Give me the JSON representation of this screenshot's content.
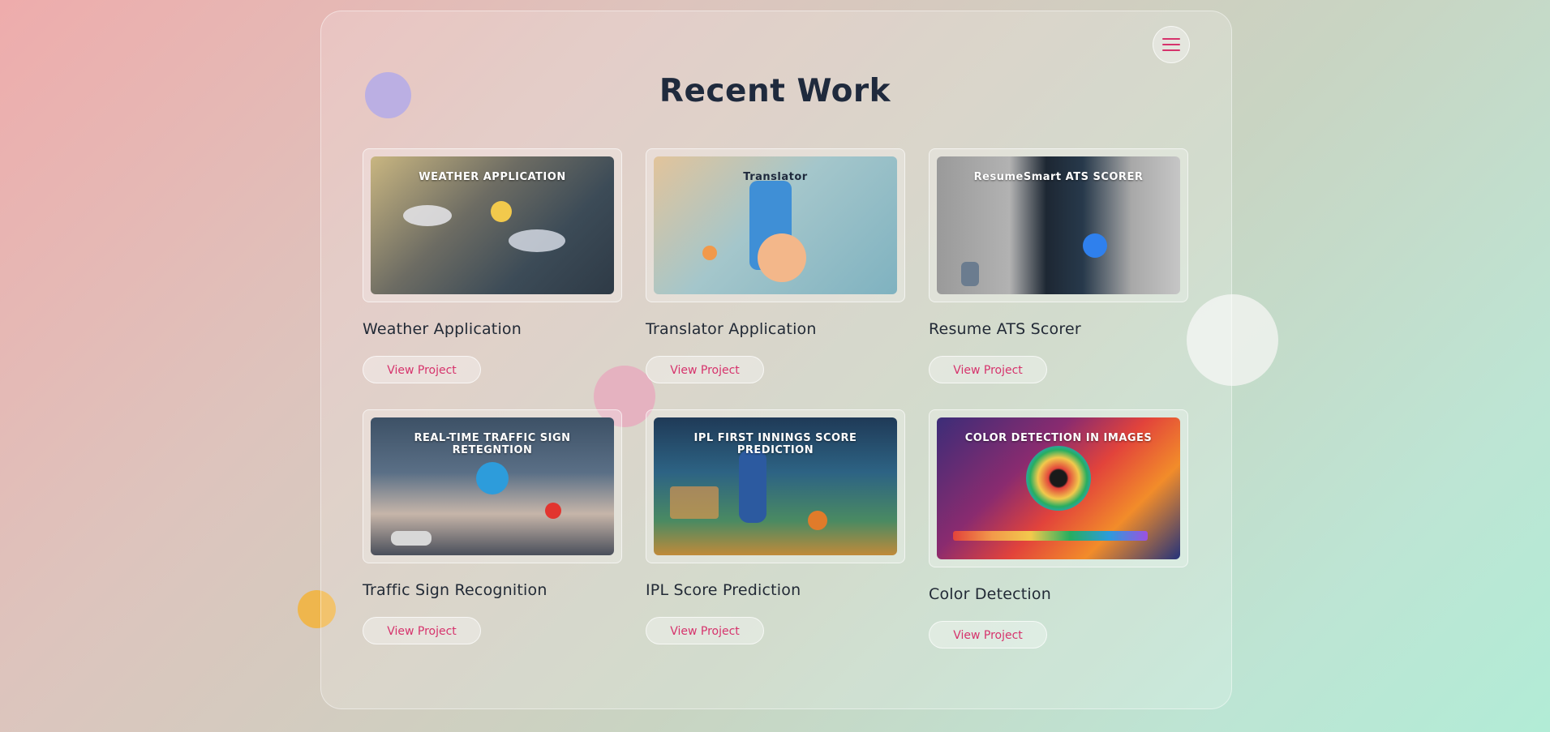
{
  "page": {
    "title": "Recent Work",
    "menu_icon": "hamburger-icon"
  },
  "colors": {
    "accent": "#d6336c",
    "title": "#1f2a3d"
  },
  "projects": [
    {
      "title": "Weather Application",
      "button": "View Project",
      "thumbnail_caption": "WEATHER APPLICATION"
    },
    {
      "title": "Translator Application",
      "button": "View Project",
      "thumbnail_caption": "Translator"
    },
    {
      "title": "Resume ATS Scorer",
      "button": "View Project",
      "thumbnail_caption": "ResumeSmart ATS SCORER"
    },
    {
      "title": "Traffic Sign Recognition",
      "button": "View Project",
      "thumbnail_caption": "REAL-TIME TRAFFIC SIGN RETEGNTION"
    },
    {
      "title": "IPL Score Prediction",
      "button": "View Project",
      "thumbnail_caption": "IPL FIRST INNINGS SCORE PREDICTION"
    },
    {
      "title": "Color Detection",
      "button": "View Project",
      "thumbnail_caption": "COLOR DETECTION IN IMAGES"
    }
  ]
}
